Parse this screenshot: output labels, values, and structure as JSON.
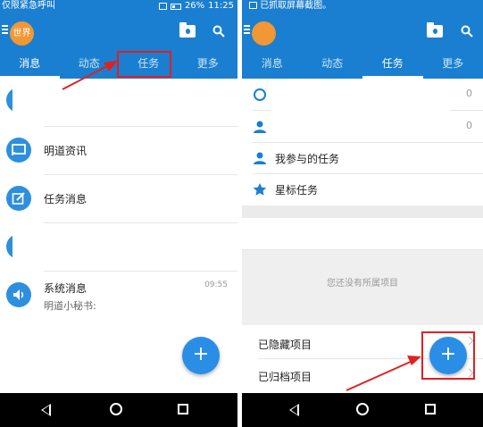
{
  "left_screen": {
    "status": {
      "carrier_text": "仅限紧急呼叫",
      "battery_percent": "26%",
      "time": "11:25"
    },
    "avatar_text": "世界",
    "tabs": [
      {
        "label": "消息"
      },
      {
        "label": "动态"
      },
      {
        "label": "任务"
      },
      {
        "label": "更多"
      }
    ],
    "messages": [
      {
        "label": "明道资讯",
        "icon": "news-icon"
      },
      {
        "label": "任务消息",
        "icon": "task-edit-icon"
      },
      {
        "label": "系统消息",
        "icon": "speaker-icon",
        "sub": "明道小秘书: ",
        "time": "09:55"
      }
    ],
    "fab_label": "+"
  },
  "right_screen": {
    "status": {
      "notification_text": "已抓取屏幕截图。"
    },
    "tabs": [
      {
        "label": "消息"
      },
      {
        "label": "动态"
      },
      {
        "label": "任务"
      },
      {
        "label": "更多"
      }
    ],
    "tasks": [
      {
        "label": "我参与的任务",
        "icon": "person-icon"
      },
      {
        "label": "星标任务",
        "icon": "star-icon"
      }
    ],
    "task_counts": [
      "0",
      "0"
    ],
    "empty_project_text": "您还没有所属项目",
    "project_links": [
      {
        "label": "已隐藏项目"
      },
      {
        "label": "已归档项目"
      }
    ],
    "fab_label": "+"
  },
  "colors": {
    "primary": "#1a7fd0",
    "accent_fab": "#2a8ee6",
    "avatar": "#f19736",
    "highlight_red": "#e02020"
  }
}
